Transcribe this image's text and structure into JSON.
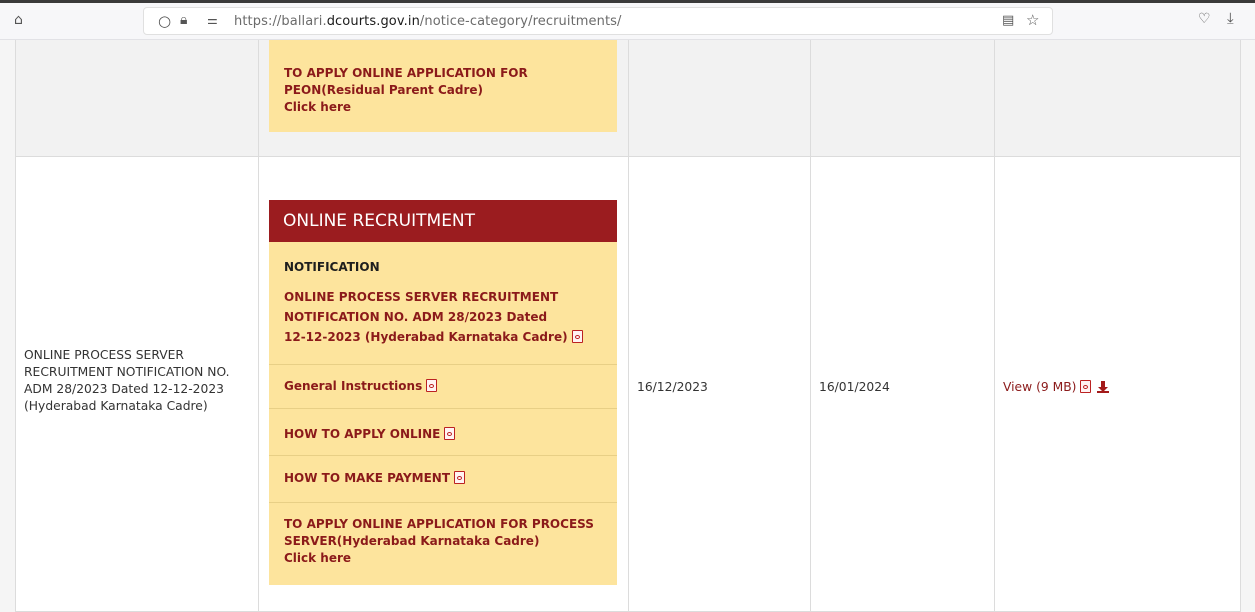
{
  "browser": {
    "url_prefix": "https://ballari.",
    "url_domain": "dcourts.gov.in",
    "url_path": "/notice-category/recruitments/"
  },
  "row1": {
    "apply_line1": "TO APPLY ONLINE APPLICATION FOR",
    "apply_line2": "PEON(Residual Parent Cadre)",
    "click_here": "Click here"
  },
  "row2": {
    "title_line1": "ONLINE PROCESS SERVER",
    "title_line2": "RECRUITMENT NOTIFICATION NO.",
    "title_line3": "ADM 28/2023 Dated 12-12-2023",
    "title_line4": "(Hyderabad Karnataka Cadre)",
    "panel_header": "ONLINE RECRUITMENT",
    "notification_label": "NOTIFICATION",
    "notif_line1": "ONLINE PROCESS SERVER RECRUITMENT",
    "notif_line2": "NOTIFICATION NO. ADM 28/2023 Dated",
    "notif_line3": "12-12-2023 (Hyderabad Karnataka Cadre)",
    "general_instructions": "General Instructions",
    "how_to_apply": "HOW TO APPLY ONLINE",
    "how_to_pay": "HOW TO MAKE PAYMENT",
    "apply_line1": "TO APPLY ONLINE APPLICATION FOR PROCESS",
    "apply_line2": "SERVER(Hyderabad Karnataka Cadre)",
    "click_here": "Click here",
    "start_date": "16/12/2023",
    "end_date": "16/01/2024",
    "view_label": "View (9 MB)"
  },
  "colors": {
    "panel_bg": "#fde49d",
    "header_bg": "#9b1c1f",
    "link_red": "#8b1a1a"
  }
}
